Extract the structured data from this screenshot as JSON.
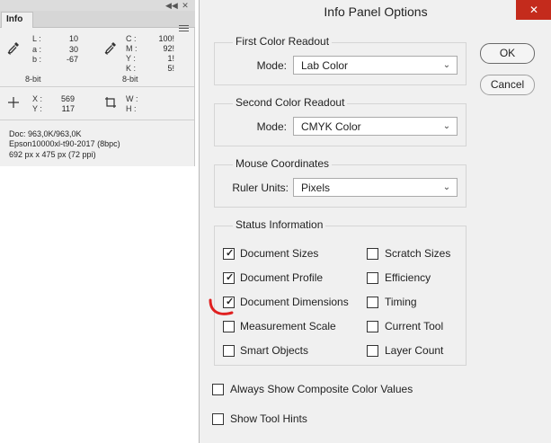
{
  "info_panel": {
    "tab_label": "Info",
    "collapse_glyph": "◀◀",
    "close_glyph": "✕",
    "first_readout": {
      "labels": [
        "L :",
        "a :",
        "b :"
      ],
      "values": [
        "10",
        "30",
        "-67"
      ],
      "bits": "8-bit",
      "icon": "eyedropper-icon"
    },
    "second_readout": {
      "labels": [
        "C :",
        "M :",
        "Y :",
        "K :"
      ],
      "values": [
        "100!",
        "92!",
        "1!",
        "5!"
      ],
      "bits": "8-bit",
      "icon": "eyedropper-icon"
    },
    "coordinates": {
      "labels": [
        "X :",
        "Y :"
      ],
      "values": [
        "569",
        "117"
      ],
      "icon": "crosshair-icon"
    },
    "dimensions": {
      "labels": [
        "W :",
        "H :"
      ],
      "values": [
        "",
        ""
      ],
      "icon": "selection-size-icon"
    },
    "status_lines": [
      "Doc: 963,0K/963,0K",
      "Epson10000xl-t90-2017 (8bpc)",
      "692 px x 475 px (72 ppi)"
    ]
  },
  "dialog": {
    "title": "Info Panel Options",
    "close_glyph": "✕",
    "ok_label": "OK",
    "cancel_label": "Cancel",
    "first_color": {
      "title": "First Color Readout",
      "mode_label": "Mode:",
      "mode_value": "Lab Color"
    },
    "second_color": {
      "title": "Second Color Readout",
      "mode_label": "Mode:",
      "mode_value": "CMYK Color"
    },
    "mouse": {
      "title": "Mouse Coordinates",
      "units_label": "Ruler Units:",
      "units_value": "Pixels"
    },
    "status": {
      "title": "Status Information",
      "left": [
        {
          "label": "Document Sizes",
          "checked": true
        },
        {
          "label": "Document Profile",
          "checked": true
        },
        {
          "label": "Document Dimensions",
          "checked": true
        },
        {
          "label": "Measurement Scale",
          "checked": false
        },
        {
          "label": "Smart Objects",
          "checked": false
        }
      ],
      "right": [
        {
          "label": "Scratch Sizes",
          "checked": false
        },
        {
          "label": "Efficiency",
          "checked": false
        },
        {
          "label": "Timing",
          "checked": false
        },
        {
          "label": "Current Tool",
          "checked": false
        },
        {
          "label": "Layer Count",
          "checked": false
        }
      ]
    },
    "composite": {
      "label": "Always Show Composite Color Values",
      "checked": false
    },
    "tool_hints": {
      "label": "Show Tool Hints",
      "checked": false
    },
    "check_glyph": "✓",
    "arrow_glyph": "⌄",
    "annotation_color": "#e02020"
  }
}
